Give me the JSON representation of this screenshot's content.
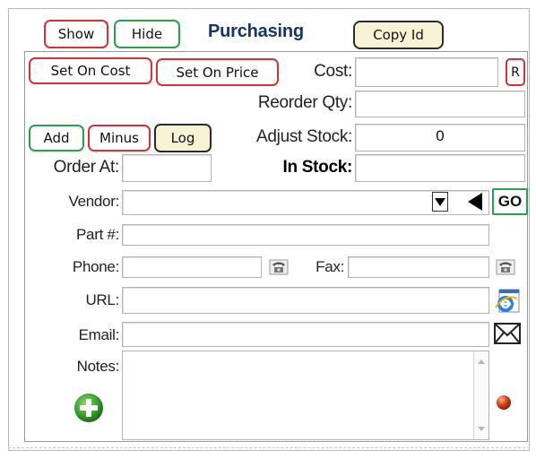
{
  "header": {
    "show_label": "Show",
    "hide_label": "Hide",
    "title": "Purchasing",
    "copy_id_label": "Copy Id"
  },
  "toolbar": {
    "set_on_cost_label": "Set On Cost",
    "set_on_price_label": "Set On Price",
    "r_label": "R",
    "add_label": "Add",
    "minus_label": "Minus",
    "log_label": "Log"
  },
  "fields": {
    "cost_label": "Cost:",
    "cost_value": "",
    "reorder_qty_label": "Reorder Qty:",
    "reorder_qty_value": "",
    "adjust_stock_label": "Adjust Stock:",
    "adjust_stock_value": "0",
    "order_at_label": "Order At:",
    "order_at_value": "",
    "in_stock_label": "In Stock:",
    "in_stock_value": "",
    "vendor_label": "Vendor:",
    "vendor_value": "",
    "go_label": "GO",
    "part_label": "Part #:",
    "part_value": "",
    "phone_label": "Phone:",
    "phone_value": "",
    "fax_label": "Fax:",
    "fax_value": "",
    "url_label": "URL:",
    "url_value": "",
    "email_label": "Email:",
    "email_value": "",
    "notes_label": "Notes:",
    "notes_value": ""
  },
  "colors": {
    "accent_green": "#2aa04a",
    "accent_red": "#d8303a",
    "title_blue": "#14356b"
  },
  "icons": [
    "phone-icon",
    "fax-phone-icon",
    "browser-icon",
    "mail-icon",
    "add-circle-icon",
    "record-dot-icon",
    "dropdown-arrow-icon",
    "back-triangle-icon"
  ]
}
